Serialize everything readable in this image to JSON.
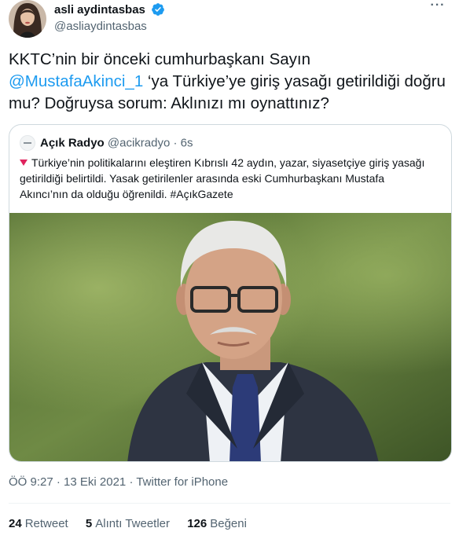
{
  "author": {
    "display_name": "asli aydintasbas",
    "handle": "@asliaydintasbas",
    "verified": true,
    "more_icon": "ellipsis-icon"
  },
  "tweet": {
    "text_before": "KKTC’nin bir önceki cumhurbaşkanı Sayın ",
    "mention": "@MustafaAkinci_1",
    "text_after": " ‘ya Türkiye’ye giriş yasağı getirildiği doğru mu? Doğruysa sorum: Aklınızı mı oynattınız?"
  },
  "quote": {
    "name": "Açık Radyo",
    "handle": "@acikradyo",
    "separator": "·",
    "time": "6s",
    "text": "Türkiye’nin politikalarını eleştiren Kıbrıslı 42 aydın, yazar, siyasetçiye giriş yasağı getirildiği belirtildi. Yasak getirilenler arasında eski Cumhurbaşkanı Mustafa Akıncı’nın da olduğu öğrenildi. #AçıkGazete"
  },
  "meta": {
    "time": "ÖÖ 9:27",
    "dot1": " · ",
    "date": "13 Eki 2021",
    "dot2": " · ",
    "source": "Twitter for iPhone"
  },
  "stats": {
    "retweets_count": "24",
    "retweets_label": "Retweet",
    "quotes_count": "5",
    "quotes_label": "Alıntı Tweetler",
    "likes_count": "126",
    "likes_label": "Beğeni"
  },
  "colors": {
    "accent": "#1d9bf0",
    "text": "#0f1419",
    "secondary": "#536471",
    "border": "#cfd9de"
  }
}
